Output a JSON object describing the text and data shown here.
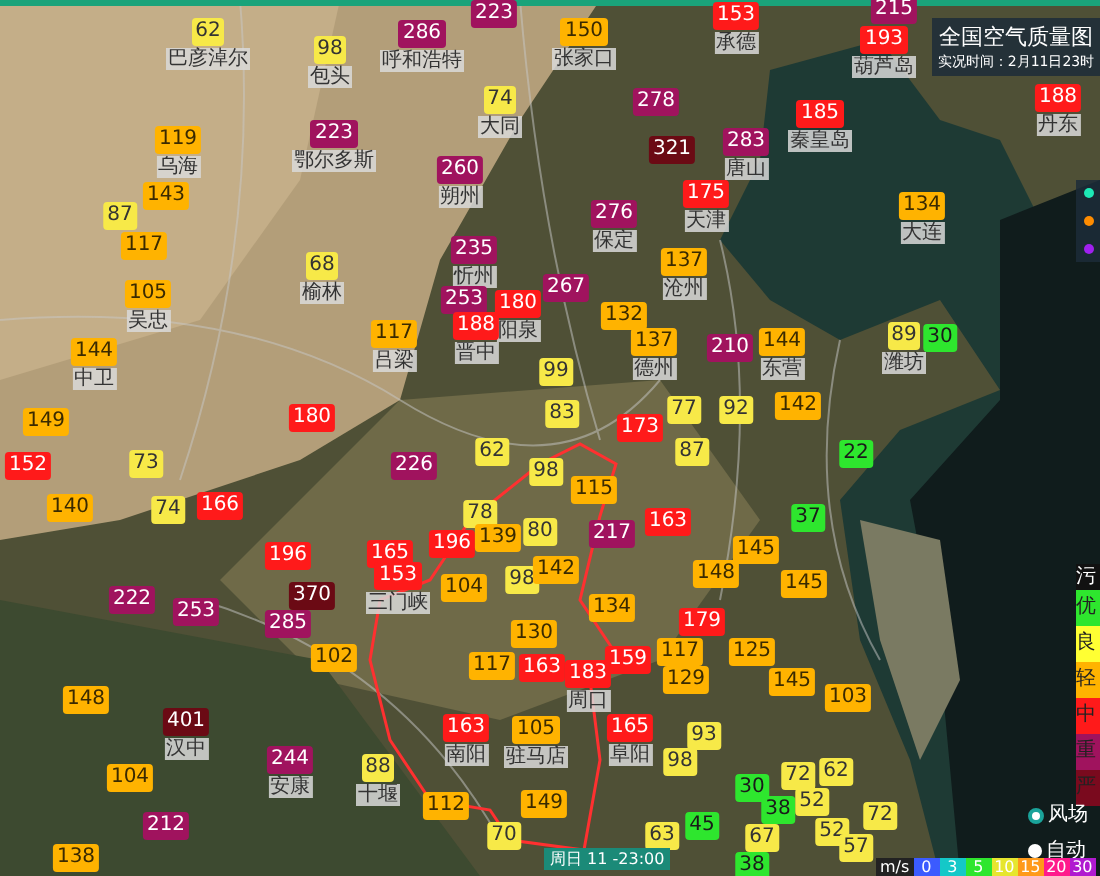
{
  "header": {
    "title": "全国空气质量图",
    "subtitle": "实况时间：2月11日23时"
  },
  "markers": [
    {
      "aqi": "62",
      "kind": "moderate",
      "name": "巴彦淖尔"
    },
    {
      "aqi": "98",
      "kind": "moderate",
      "name": "包头"
    },
    {
      "aqi": "286",
      "kind": "heavy",
      "name": "呼和浩特"
    },
    {
      "aqi": "223",
      "kind": "heavy"
    },
    {
      "aqi": "150",
      "kind": "light",
      "name": "张家口"
    },
    {
      "aqi": "153",
      "kind": "medium",
      "name": "承德"
    },
    {
      "aqi": "215",
      "kind": "heavy"
    },
    {
      "aqi": "193",
      "kind": "medium",
      "name": "葫芦岛"
    },
    {
      "aqi": "119",
      "kind": "light",
      "name": "乌海"
    },
    {
      "aqi": "223",
      "kind": "heavy",
      "name": "鄂尔多斯"
    },
    {
      "aqi": "74",
      "kind": "moderate",
      "name": "大同"
    },
    {
      "aqi": "278",
      "kind": "heavy"
    },
    {
      "aqi": "321",
      "kind": "severe"
    },
    {
      "aqi": "283",
      "kind": "heavy",
      "name": "唐山"
    },
    {
      "aqi": "185",
      "kind": "medium",
      "name": "秦皇岛"
    },
    {
      "aqi": "188",
      "kind": "medium",
      "name": "丹东"
    },
    {
      "aqi": "87",
      "kind": "moderate"
    },
    {
      "aqi": "143",
      "kind": "light"
    },
    {
      "aqi": "260",
      "kind": "heavy",
      "name": "朔州"
    },
    {
      "aqi": "276",
      "kind": "heavy",
      "name": "保定"
    },
    {
      "aqi": "175",
      "kind": "medium",
      "name": "天津"
    },
    {
      "aqi": "134",
      "kind": "light",
      "name": "大连"
    },
    {
      "aqi": "117",
      "kind": "light"
    },
    {
      "aqi": "105",
      "kind": "light",
      "name": "吴忠"
    },
    {
      "aqi": "68",
      "kind": "moderate",
      "name": "榆林"
    },
    {
      "aqi": "235",
      "kind": "heavy",
      "name": "忻州"
    },
    {
      "aqi": "253",
      "kind": "heavy"
    },
    {
      "aqi": "180",
      "kind": "medium",
      "name": "阳泉"
    },
    {
      "aqi": "267",
      "kind": "heavy"
    },
    {
      "aqi": "137",
      "kind": "light",
      "name": "沧州"
    },
    {
      "aqi": "144",
      "kind": "light",
      "name": "中卫"
    },
    {
      "aqi": "117",
      "kind": "light",
      "name": "吕梁"
    },
    {
      "aqi": "188",
      "kind": "medium",
      "name": "晋中"
    },
    {
      "aqi": "99",
      "kind": "moderate"
    },
    {
      "aqi": "132",
      "kind": "light"
    },
    {
      "aqi": "137",
      "kind": "light",
      "name": "德州"
    },
    {
      "aqi": "210",
      "kind": "heavy"
    },
    {
      "aqi": "144",
      "kind": "light",
      "name": "东营"
    },
    {
      "aqi": "89",
      "kind": "moderate",
      "name": "潍坊"
    },
    {
      "aqi": "30",
      "kind": "good"
    },
    {
      "aqi": "149",
      "kind": "light"
    },
    {
      "aqi": "180",
      "kind": "medium"
    },
    {
      "aqi": "83",
      "kind": "moderate"
    },
    {
      "aqi": "173",
      "kind": "medium"
    },
    {
      "aqi": "77",
      "kind": "moderate"
    },
    {
      "aqi": "92",
      "kind": "moderate"
    },
    {
      "aqi": "142",
      "kind": "light"
    },
    {
      "aqi": "152",
      "kind": "medium"
    },
    {
      "aqi": "73",
      "kind": "moderate"
    },
    {
      "aqi": "226",
      "kind": "heavy"
    },
    {
      "aqi": "62",
      "kind": "moderate"
    },
    {
      "aqi": "98",
      "kind": "moderate"
    },
    {
      "aqi": "115",
      "kind": "light"
    },
    {
      "aqi": "87",
      "kind": "moderate"
    },
    {
      "aqi": "22",
      "kind": "good"
    },
    {
      "aqi": "140",
      "kind": "light"
    },
    {
      "aqi": "74",
      "kind": "moderate"
    },
    {
      "aqi": "166",
      "kind": "medium"
    },
    {
      "aqi": "196",
      "kind": "medium"
    },
    {
      "aqi": "165",
      "kind": "medium"
    },
    {
      "aqi": "78",
      "kind": "moderate"
    },
    {
      "aqi": "196",
      "kind": "medium"
    },
    {
      "aqi": "139",
      "kind": "light"
    },
    {
      "aqi": "80",
      "kind": "moderate"
    },
    {
      "aqi": "217",
      "kind": "heavy"
    },
    {
      "aqi": "163",
      "kind": "medium"
    },
    {
      "aqi": "145",
      "kind": "light"
    },
    {
      "aqi": "37",
      "kind": "good"
    },
    {
      "aqi": "222",
      "kind": "heavy"
    },
    {
      "aqi": "253",
      "kind": "heavy"
    },
    {
      "aqi": "285",
      "kind": "heavy"
    },
    {
      "aqi": "370",
      "kind": "severe"
    },
    {
      "aqi": "153",
      "kind": "medium",
      "name": "三门峡"
    },
    {
      "aqi": "104",
      "kind": "light"
    },
    {
      "aqi": "98",
      "kind": "moderate"
    },
    {
      "aqi": "142",
      "kind": "light"
    },
    {
      "aqi": "134",
      "kind": "light"
    },
    {
      "aqi": "148",
      "kind": "light"
    },
    {
      "aqi": "179",
      "kind": "medium"
    },
    {
      "aqi": "145",
      "kind": "light"
    },
    {
      "aqi": "148",
      "kind": "light"
    },
    {
      "aqi": "401",
      "kind": "severe",
      "name": "汉中"
    },
    {
      "aqi": "102",
      "kind": "light"
    },
    {
      "aqi": "130",
      "kind": "light"
    },
    {
      "aqi": "117",
      "kind": "light"
    },
    {
      "aqi": "163",
      "kind": "medium",
      "name": "南阳"
    },
    {
      "aqi": "163",
      "kind": "medium"
    },
    {
      "aqi": "105",
      "kind": "light",
      "name": "驻马店"
    },
    {
      "aqi": "183",
      "kind": "medium",
      "name": "周口"
    },
    {
      "aqi": "159",
      "kind": "medium"
    },
    {
      "aqi": "165",
      "kind": "medium",
      "name": "阜阳"
    },
    {
      "aqi": "117",
      "kind": "light"
    },
    {
      "aqi": "129",
      "kind": "light"
    },
    {
      "aqi": "93",
      "kind": "moderate"
    },
    {
      "aqi": "125",
      "kind": "light"
    },
    {
      "aqi": "145",
      "kind": "light"
    },
    {
      "aqi": "103",
      "kind": "light"
    },
    {
      "aqi": "138",
      "kind": "light"
    },
    {
      "aqi": "104",
      "kind": "light"
    },
    {
      "aqi": "212",
      "kind": "heavy"
    },
    {
      "aqi": "244",
      "kind": "heavy",
      "name": "安康"
    },
    {
      "aqi": "88",
      "kind": "moderate",
      "name": "十堰"
    },
    {
      "aqi": "112",
      "kind": "light"
    },
    {
      "aqi": "149",
      "kind": "light"
    },
    {
      "aqi": "70",
      "kind": "moderate"
    },
    {
      "aqi": "98",
      "kind": "moderate"
    },
    {
      "aqi": "63",
      "kind": "moderate"
    },
    {
      "aqi": "45",
      "kind": "good"
    },
    {
      "aqi": "30",
      "kind": "good"
    },
    {
      "aqi": "38",
      "kind": "good"
    },
    {
      "aqi": "67",
      "kind": "moderate"
    },
    {
      "aqi": "38",
      "kind": "good"
    },
    {
      "aqi": "72",
      "kind": "moderate"
    },
    {
      "aqi": "62",
      "kind": "moderate"
    },
    {
      "aqi": "52",
      "kind": "moderate"
    },
    {
      "aqi": "52",
      "kind": "moderate"
    },
    {
      "aqi": "72",
      "kind": "moderate"
    },
    {
      "aqi": "57",
      "kind": "moderate"
    }
  ],
  "layer_dots": [
    {
      "color": "#1de9b6"
    },
    {
      "color": "#ff8c00"
    },
    {
      "color": "#a020f0"
    }
  ],
  "legend": {
    "title": "污",
    "levels": [
      {
        "label": "优",
        "color": "#2ee62e"
      },
      {
        "label": "良",
        "color": "#ffff33"
      },
      {
        "label": "轻",
        "color": "#ffb300"
      },
      {
        "label": "中",
        "color": "#ff1a1a"
      },
      {
        "label": "重",
        "color": "#a0135e"
      },
      {
        "label": "严",
        "color": "#7a0a1e"
      }
    ]
  },
  "toggles": [
    {
      "label": "风场",
      "on": true
    },
    {
      "label": "自动",
      "on": false
    }
  ],
  "time_badge": "周日 11 -23:00",
  "wind_scale": {
    "unit": "m/s",
    "steps": [
      {
        "label": "0",
        "color": "#3b5bff"
      },
      {
        "label": "3",
        "color": "#14c8c8"
      },
      {
        "label": "5",
        "color": "#2ee62e"
      },
      {
        "label": "10",
        "color": "#e6e62e"
      },
      {
        "label": "15",
        "color": "#ff9a1a"
      },
      {
        "label": "20",
        "color": "#ff1a8c"
      },
      {
        "label": "30",
        "color": "#b01ad0"
      }
    ]
  }
}
